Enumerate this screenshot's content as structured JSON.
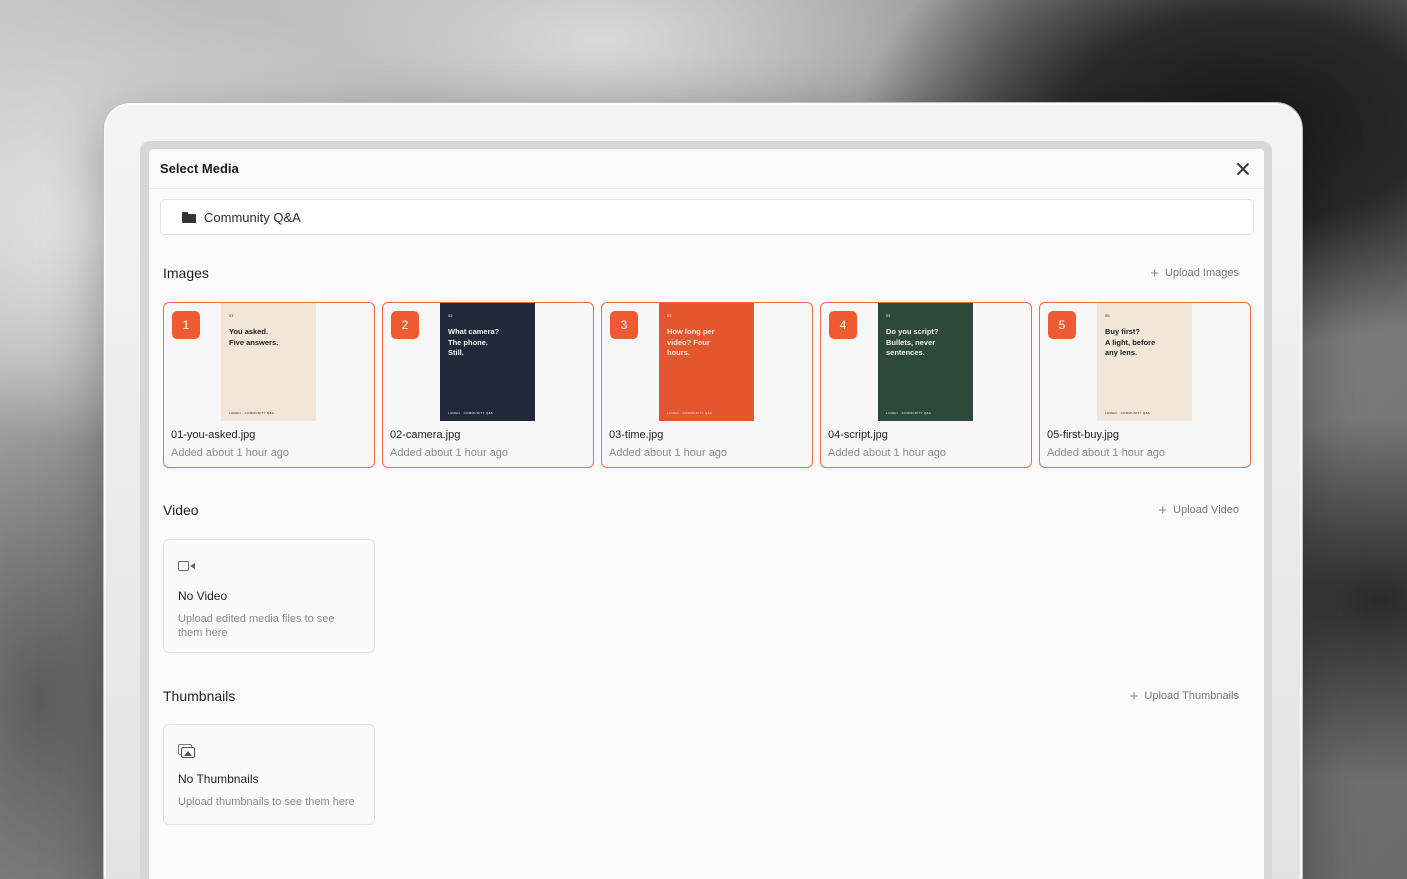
{
  "modal": {
    "title": "Select Media",
    "folder": "Community Q&A"
  },
  "images_section": {
    "title": "Images",
    "upload_label": "Upload Images",
    "items": [
      {
        "badge": "1",
        "file": "01-you-asked.jpg",
        "meta": "Added about 1 hour ago",
        "thumb_num": "01",
        "thumb_text": "You asked.\nFive answers.",
        "thumb_foot": "LUMEN · COMMUNITY Q&A",
        "bg": "#f2e6d8",
        "fg": "#1c1c1c"
      },
      {
        "badge": "2",
        "file": "02-camera.jpg",
        "meta": "Added about 1 hour ago",
        "thumb_num": "02",
        "thumb_text": "What camera?\nThe phone.\nStill.",
        "thumb_foot": "LUMEN · COMMUNITY Q&A",
        "bg": "#1e2a3a",
        "fg": "#f4f4f4"
      },
      {
        "badge": "3",
        "file": "03-time.jpg",
        "meta": "Added about 1 hour ago",
        "thumb_num": "03",
        "thumb_text": "How long per\nvideo? Four\nhours.",
        "thumb_foot": "LUMEN · COMMUNITY Q&A",
        "bg": "#e4572e",
        "fg": "#fbe4d8"
      },
      {
        "badge": "4",
        "file": "04-script.jpg",
        "meta": "Added about 1 hour ago",
        "thumb_num": "04",
        "thumb_text": "Do you script?\nBullets, never\nsentences.",
        "thumb_foot": "LUMEN · COMMUNITY Q&A",
        "bg": "#2d4a38",
        "fg": "#f1f1f1"
      },
      {
        "badge": "5",
        "file": "05-first-buy.jpg",
        "meta": "Added about 1 hour ago",
        "thumb_num": "05",
        "thumb_text": "Buy first?\nA light, before\nany lens.",
        "thumb_foot": "LUMEN · COMMUNITY Q&A",
        "bg": "#f2e6d8",
        "fg": "#1c1c1c"
      }
    ]
  },
  "video_section": {
    "title": "Video",
    "upload_label": "Upload Video",
    "empty_title": "No Video",
    "empty_desc": "Upload edited media files to see them here"
  },
  "thumbnails_section": {
    "title": "Thumbnails",
    "upload_label": "Upload Thumbnails",
    "empty_title": "No Thumbnails",
    "empty_desc": "Upload thumbnails to see them here"
  },
  "colors": {
    "accent": "#ef5a33",
    "card_border": "#ef6b4a"
  }
}
